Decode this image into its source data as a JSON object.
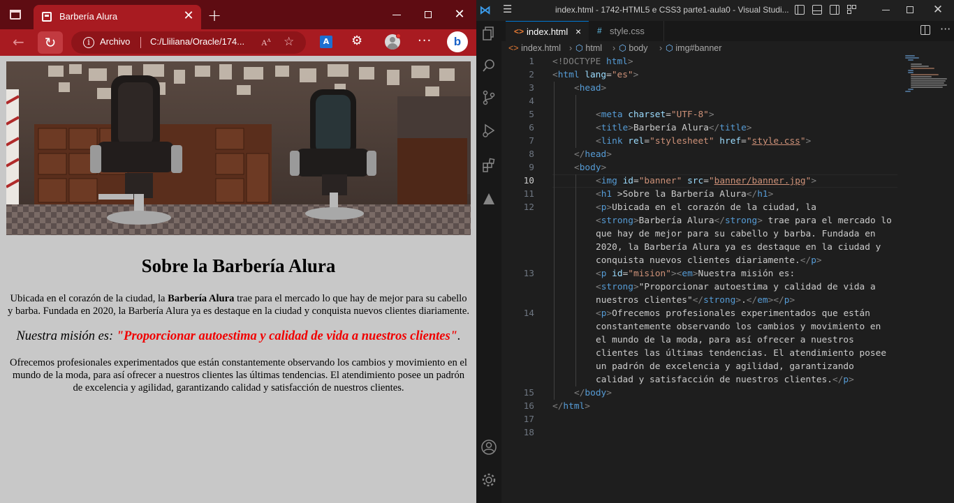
{
  "browser": {
    "tab": {
      "title": "Barbería Alura"
    },
    "address": {
      "label": "Archivo",
      "url": "C:/Lliliana/Oracle/174..."
    },
    "toolbar_icons": [
      "back-arrow-icon",
      "refresh-icon",
      "info-icon",
      "read-aloud-icon",
      "favorites-icon",
      "translate-icon",
      "extensions-icon",
      "profile-icon",
      "more-icon",
      "bing-icon"
    ],
    "accent_color": "#a81b21"
  },
  "page": {
    "heading": "Sobre la Barbería Alura",
    "p1_before": "Ubicada en el corazón de la ciudad, la ",
    "p1_strong": "Barbería Alura",
    "p1_after": " trae para el mercado lo que hay de mejor para su cabello y barba. Fundada en 2020, la Barbería Alura ya es destaque en la ciudad y conquista nuevos clientes diariamente.",
    "mission_em": "Nuestra misión es: ",
    "mission_strong": "\"Proporcionar autoestima y calidad de vida a nuestros clientes\"",
    "mission_after": ".",
    "p3": "Ofrecemos profesionales experimentados que están constantemente observando los cambios y movimiento en el mundo de la moda, para así ofrecer a nuestros clientes las últimas tendencias. El atendimiento posee un padrón de excelencia y agilidad, garantizando calidad y satisfacción de nuestros clientes."
  },
  "vscode": {
    "window_title": "index.html - 1742-HTML5 e CSS3 parte1-aula0 - Visual Studi...",
    "tabs": [
      {
        "label": "index.html",
        "icon": "<>",
        "close": "×"
      },
      {
        "label": "style.css",
        "icon": "#"
      }
    ],
    "breadcrumbs": [
      "index.html",
      "html",
      "body",
      "img#banner"
    ],
    "line_numbers": [
      "1",
      "2",
      "3",
      "4",
      "5",
      "6",
      "7",
      "8",
      "9",
      "10",
      "11",
      "12",
      "13",
      "14",
      "15",
      "16",
      "17",
      "18"
    ],
    "active_line": "10",
    "code": {
      "l1_a": "<!DOCTYPE ",
      "l1_b": "html",
      "l1_c": ">",
      "l2_tag": "html",
      "l2_attr": "lang",
      "l2_val": "\"es\"",
      "l3_tag": "head",
      "l5_tag": "meta",
      "l5_attr": "charset",
      "l5_val": "\"UTF-8\"",
      "l6_tag": "title",
      "l6_text": "Barbería Alura",
      "l7_tag": "link",
      "l7_attr1": "rel",
      "l7_val1": "\"stylesheet\"",
      "l7_attr2": "href",
      "l7_val2": "style.css",
      "l8_tag": "head",
      "l9_tag": "body",
      "l10_tag": "img",
      "l10_attr1": "id",
      "l10_val1": "\"banner\"",
      "l10_attr2": "src",
      "l10_val2": "banner/banner.jpg",
      "l11_tag": "h1",
      "l11_text": ">Sobre la Barbería Alura",
      "l12_w1": "Ubicada en el corazón de la ciudad, la",
      "l12_w2_tag": "strong",
      "l12_w2_text": "Barbería Alura",
      "l12_w2_after": " trae para el mercado lo",
      "l12_w3": "que hay de mejor para su cabello y barba. Fundada en",
      "l12_w4": "2020, la Barbería Alura ya es destaque en la ciudad y",
      "l12_w5": "conquista nuevos clientes diariamente.",
      "l13_attr": "id",
      "l13_val": "\"mision\"",
      "l13_text": "Nuestra misión es:",
      "l13_w2": "\"Proporcionar autoestima y calidad de vida a",
      "l13_w3": "nuestros clientes\"",
      "l13_w3_after": ".",
      "l14_w1": "Ofrecemos profesionales experimentados que están",
      "l14_w2": "constantemente observando los cambios y movimiento en",
      "l14_w3": "el mundo de la moda, para así ofrecer a nuestros",
      "l14_w4": "clientes las últimas tendencias. El atendimiento posee",
      "l14_w5": "un padrón de excelencia y agilidad, garantizando",
      "l14_w6": "calidad y satisfacción de nuestros clientes.",
      "l15_tag": "body",
      "l16_tag": "html"
    },
    "activity_icons": [
      "explorer-icon",
      "search-icon",
      "source-control-icon",
      "run-debug-icon",
      "extensions-icon",
      "alura-icon",
      "account-icon",
      "settings-icon"
    ]
  }
}
